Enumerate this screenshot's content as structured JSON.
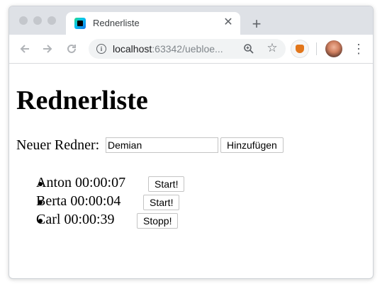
{
  "browser": {
    "tab_title": "Rednerliste",
    "close_glyph": "✕",
    "new_tab_glyph": "+",
    "url_host": "localhost",
    "url_rest": ":63342/uebloe..."
  },
  "page": {
    "heading": "Rednerliste",
    "form": {
      "label": "Neuer Redner:",
      "input_value": "Demian",
      "add_button": "Hinzufügen"
    },
    "speakers": [
      {
        "name": "Anton",
        "time": "00:00:07",
        "button": "Start!"
      },
      {
        "name": "Berta",
        "time": "00:00:04",
        "button": "Start!"
      },
      {
        "name": "Carl",
        "time": "00:00:39",
        "button": "Stopp!"
      }
    ]
  },
  "icons": {
    "back": "back-arrow-icon",
    "forward": "forward-arrow-icon",
    "reload": "reload-icon",
    "info": "info-icon",
    "zoom": "zoom-icon",
    "star": "bookmark-star-icon",
    "extension": "fox-extension-icon",
    "menu": "kebab-menu-icon"
  }
}
